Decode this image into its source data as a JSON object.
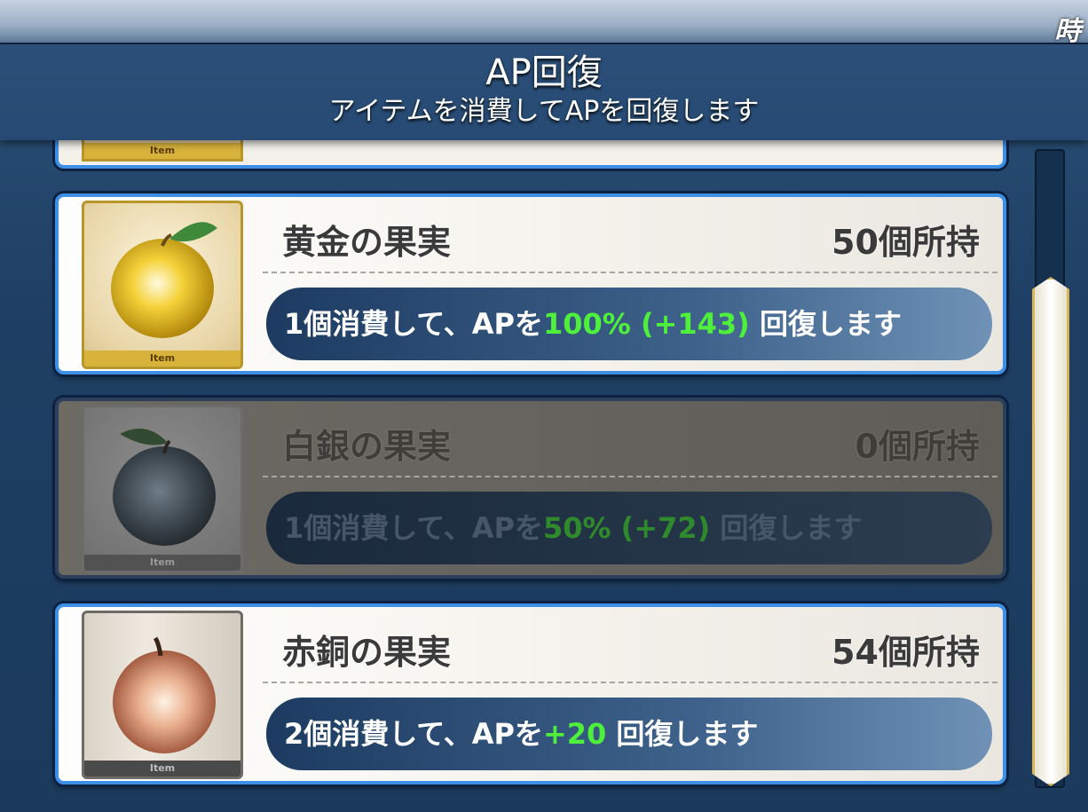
{
  "header": {
    "title": "AP回復",
    "subtitle": "アイテムを消費してAPを回復します"
  },
  "corner_text": "時",
  "item_tag": "Item",
  "items": [
    {
      "name": "黄金の果実",
      "count_text": "50個所持",
      "desc_prefix": "1個消費して、APを",
      "desc_highlight": "100% (+143)",
      "desc_suffix": " 回復します",
      "enabled": true,
      "icon": "golden-apple-icon"
    },
    {
      "name": "白銀の果実",
      "count_text": "0個所持",
      "desc_prefix": "1個消費して、APを",
      "desc_highlight": "50% (+72)",
      "desc_suffix": " 回復します",
      "enabled": false,
      "icon": "silver-apple-icon"
    },
    {
      "name": "赤銅の果実",
      "count_text": "54個所持",
      "desc_prefix": "2個消費して、APを",
      "desc_highlight": "+20",
      "desc_suffix": " 回復します",
      "enabled": true,
      "icon": "bronze-apple-icon"
    }
  ],
  "colors": {
    "highlight": "#4ef03c",
    "card_border": "#3e8fe6",
    "header_bg": "#264a73"
  },
  "scroll_position": 0.65
}
